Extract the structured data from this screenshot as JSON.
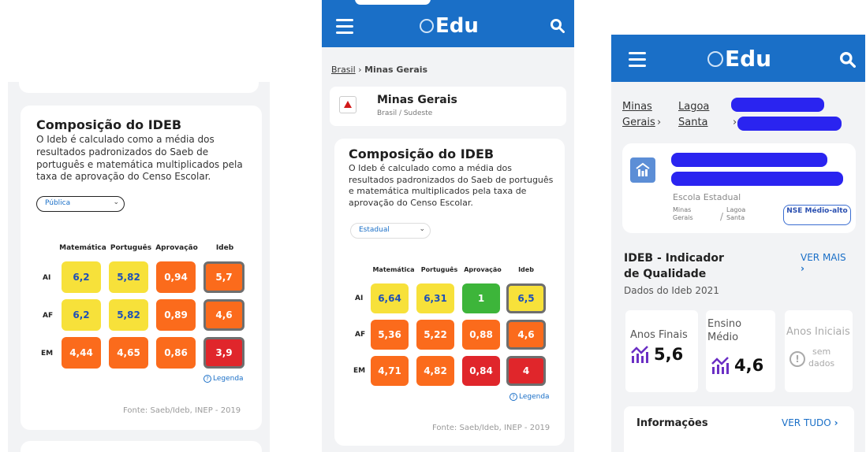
{
  "panel1": {
    "title": "Composição do IDEB",
    "description": "O Ideb é calculado como a média dos resultados padronizados do Saeb de português e matemática multiplicados pela taxa de aprovação do Censo Escolar.",
    "select_value": "Pública",
    "columns": [
      "Matemática",
      "Português",
      "Aprovação",
      "Ideb"
    ],
    "rows": [
      {
        "label": "AI",
        "values": [
          "6,2",
          "5,82",
          "0,94",
          "5,7"
        ],
        "colors": [
          "#f7e13a",
          "#f7e13a",
          "#fb6b1c",
          "#fb6b1c"
        ]
      },
      {
        "label": "AF",
        "values": [
          "6,2",
          "5,82",
          "0,89",
          "4,6"
        ],
        "colors": [
          "#f7e13a",
          "#f7e13a",
          "#fb6b1c",
          "#fb6b1c"
        ]
      },
      {
        "label": "EM",
        "values": [
          "4,44",
          "4,65",
          "0,86",
          "3,9"
        ],
        "colors": [
          "#fb6b1c",
          "#fb6b1c",
          "#fb6b1c",
          "#e0262b"
        ]
      }
    ],
    "legend": "Legenda",
    "source": "Fonte: Saeb/Ideb, INEP - 2019"
  },
  "panel2": {
    "brand": "Edu",
    "breadcrumb": {
      "link": "Brasil",
      "current": "Minas Gerais"
    },
    "location": {
      "name": "Minas Gerais",
      "sub": "Brasil / Sudeste"
    },
    "title": "Composição do IDEB",
    "description": "O Ideb é calculado como a média dos resultados padronizados do Saeb de português e matemática multiplicados pela taxa de aprovação do Censo Escolar.",
    "select_value": "Estadual",
    "columns": [
      "Matemática",
      "Português",
      "Aprovação",
      "Ideb"
    ],
    "rows": [
      {
        "label": "AI",
        "values": [
          "6,64",
          "6,31",
          "1",
          "6,5"
        ],
        "colors": [
          "#f7e13a",
          "#f7e13a",
          "#3db53a",
          "#f7e13a"
        ]
      },
      {
        "label": "AF",
        "values": [
          "5,36",
          "5,22",
          "0,88",
          "4,6"
        ],
        "colors": [
          "#fb6b1c",
          "#fb6b1c",
          "#fb6b1c",
          "#fb6b1c"
        ]
      },
      {
        "label": "EM",
        "values": [
          "4,71",
          "4,82",
          "0,84",
          "4"
        ],
        "colors": [
          "#fb6b1c",
          "#fb6b1c",
          "#e0262b",
          "#e0262b"
        ]
      }
    ],
    "legend": "Legenda",
    "source": "Fonte: Saeb/Ideb, INEP - 2019"
  },
  "panel3": {
    "brand": "Edu",
    "breadcrumb": {
      "item1a": "Minas",
      "item1b": "Gerais",
      "item2a": "Lagoa",
      "item2b": "Santa"
    },
    "school": {
      "type": "Escola Estadual",
      "city_a": "Minas",
      "city_b": "Gerais",
      "town_a": "Lagoa",
      "town_b": "Santa",
      "badge": "NSE Médio-alto"
    },
    "ideb_title": "IDEB - Indicador de Qualidade",
    "ver_mais": "VER MAIS",
    "ideb_sub": "Dados do Ideb 2021",
    "stats": [
      {
        "label": "Anos Finais",
        "value": "5,6"
      },
      {
        "label_a": "Ensino",
        "label_b": "Médio",
        "value": "4,6"
      },
      {
        "label": "Anos Iniciais",
        "nodata_a": "sem",
        "nodata_b": "dados"
      }
    ],
    "info_title": "Informações",
    "ver_tudo": "VER TUDO"
  },
  "colors": {
    "brand_blue": "#1a6fc7",
    "yellow": "#f7e13a",
    "orange": "#fb6b1c",
    "red": "#e0262b",
    "green": "#3db53a",
    "purple": "#6b2fc4",
    "redaction": "#2a24f0"
  }
}
